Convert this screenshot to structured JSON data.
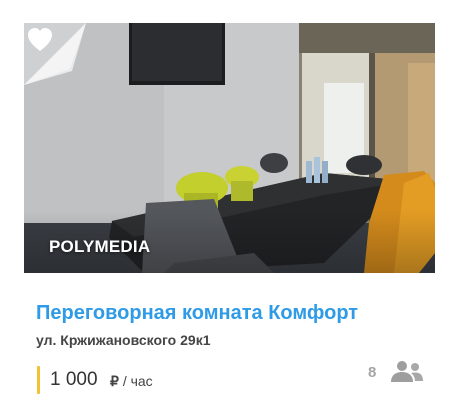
{
  "listing": {
    "brand": "POLYMEDIA",
    "title": "Переговорная комната Комфорт",
    "address": "ул. Кржижановского 29к1",
    "price": {
      "amount": "1 000",
      "currency": "₽",
      "period": "/ час"
    },
    "capacity": "8"
  },
  "icons": {
    "favorite": "heart-icon",
    "capacity": "people-icon"
  },
  "colors": {
    "title_link": "#2f9be6",
    "price_accent": "#f2c233",
    "capacity_text": "#a5a5a5"
  }
}
